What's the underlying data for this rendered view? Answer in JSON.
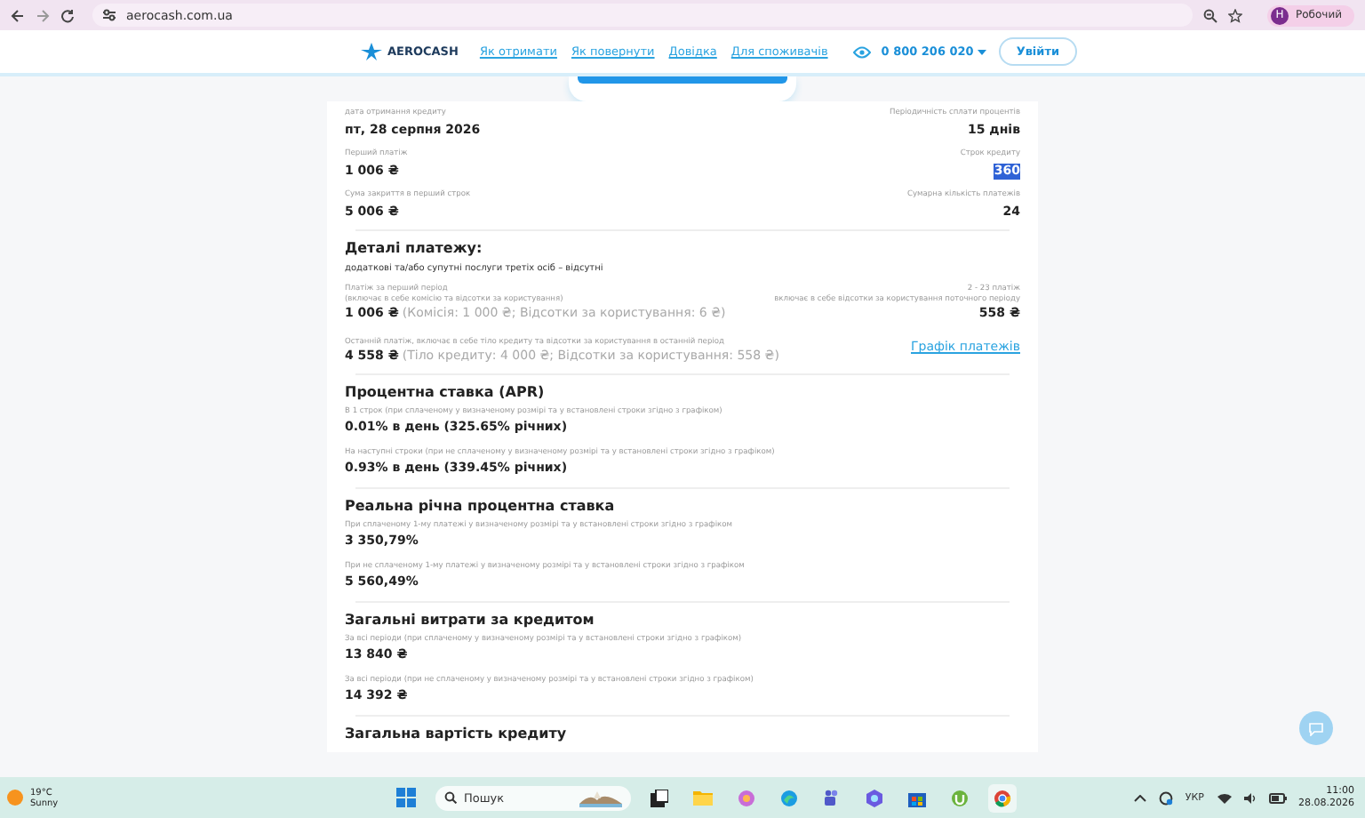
{
  "browser": {
    "url": "aerocash.com.ua",
    "profile_initial": "Н",
    "profile_name": "Робочий"
  },
  "header": {
    "logo": "AEROCASH",
    "nav": [
      "Як отримати",
      "Як повернути",
      "Довідка",
      "Для споживачів"
    ],
    "phone": "0 800 206 020",
    "login": "Увійти"
  },
  "summary": [
    {
      "left": {
        "label": "дата отримання кредиту",
        "value": "пт, 28 серпня 2026",
        "text_selected": false
      },
      "right": {
        "label": "Періодичність сплати процентів",
        "value": "15 днів",
        "text_selected": false
      }
    },
    {
      "left": {
        "label": "Перший платіж",
        "value": "1 006 ₴",
        "text_selected": false
      },
      "right": {
        "label": "Строк кредиту",
        "value": "360",
        "text_selected": true
      }
    },
    {
      "left": {
        "label": "Сума закриття в перший строк",
        "value": "5 006 ₴",
        "text_selected": false
      },
      "right": {
        "label": "Сумарна кількість платежів",
        "value": "24",
        "text_selected": false
      }
    }
  ],
  "payment_details": {
    "title": "Деталі платежу:",
    "subtitle": "додаткові та/або супутні послуги третіх осіб – відсутні",
    "first": {
      "label": "Платіж за перший період",
      "note": "(включає в себе комісію та відсотки за користування)",
      "value": "1 006 ₴",
      "detail": "(Комісія: 1 000 ₴; Відсотки за користування: 6 ₴)"
    },
    "regular": {
      "label": "2 - 23 платіж",
      "note": "включає в себе відсотки за користування поточного періоду",
      "value": "558 ₴"
    },
    "last": {
      "label": "Останній платіж, включає в себе тіло кредиту та відсотки за користування в останній період",
      "value": "4 558 ₴",
      "detail": "(Тіло кредиту: 4 000 ₴; Відсотки за користування: 558 ₴)"
    },
    "schedule_link": "Графік платежів"
  },
  "sections": [
    {
      "title": "Процентна ставка (APR)",
      "items": [
        {
          "label": "В 1 строк (при сплаченому у визначеному розмірі та у встановлені строки згідно з графіком)",
          "value": "0.01% в день (325.65% річних)"
        },
        {
          "label": "На наступні строки (при не сплаченому у визначеному розмірі та у встановлені строки згідно з графіком)",
          "value": "0.93% в день (339.45% річних)"
        }
      ]
    },
    {
      "title": "Реальна річна процентна ставка",
      "items": [
        {
          "label": "При сплаченому 1-му платежі у визначеному розмірі та у встановлені строки згідно з графіком",
          "value": "3 350,79%"
        },
        {
          "label": "При не сплаченому 1-му платежі у визначеному розмірі та у встановлені строки згідно з графіком",
          "value": "5 560,49%"
        }
      ]
    },
    {
      "title": "Загальні витрати за кредитом",
      "items": [
        {
          "label": "За всі періоди (при сплаченому у визначеному розмірі та у встановлені строки згідно з графіком)",
          "value": "13 840 ₴"
        },
        {
          "label": "За всі періоди (при не сплаченому у визначеному розмірі та у встановлені строки згідно з графіком)",
          "value": "14 392 ₴"
        }
      ]
    }
  ],
  "next_section_title": "Загальна вартість кредиту",
  "taskbar": {
    "temperature": "19°C",
    "weather": "Sunny",
    "search_placeholder": "Пошук",
    "language": "УКР",
    "time": "11:00",
    "date": "28.08.2026"
  }
}
